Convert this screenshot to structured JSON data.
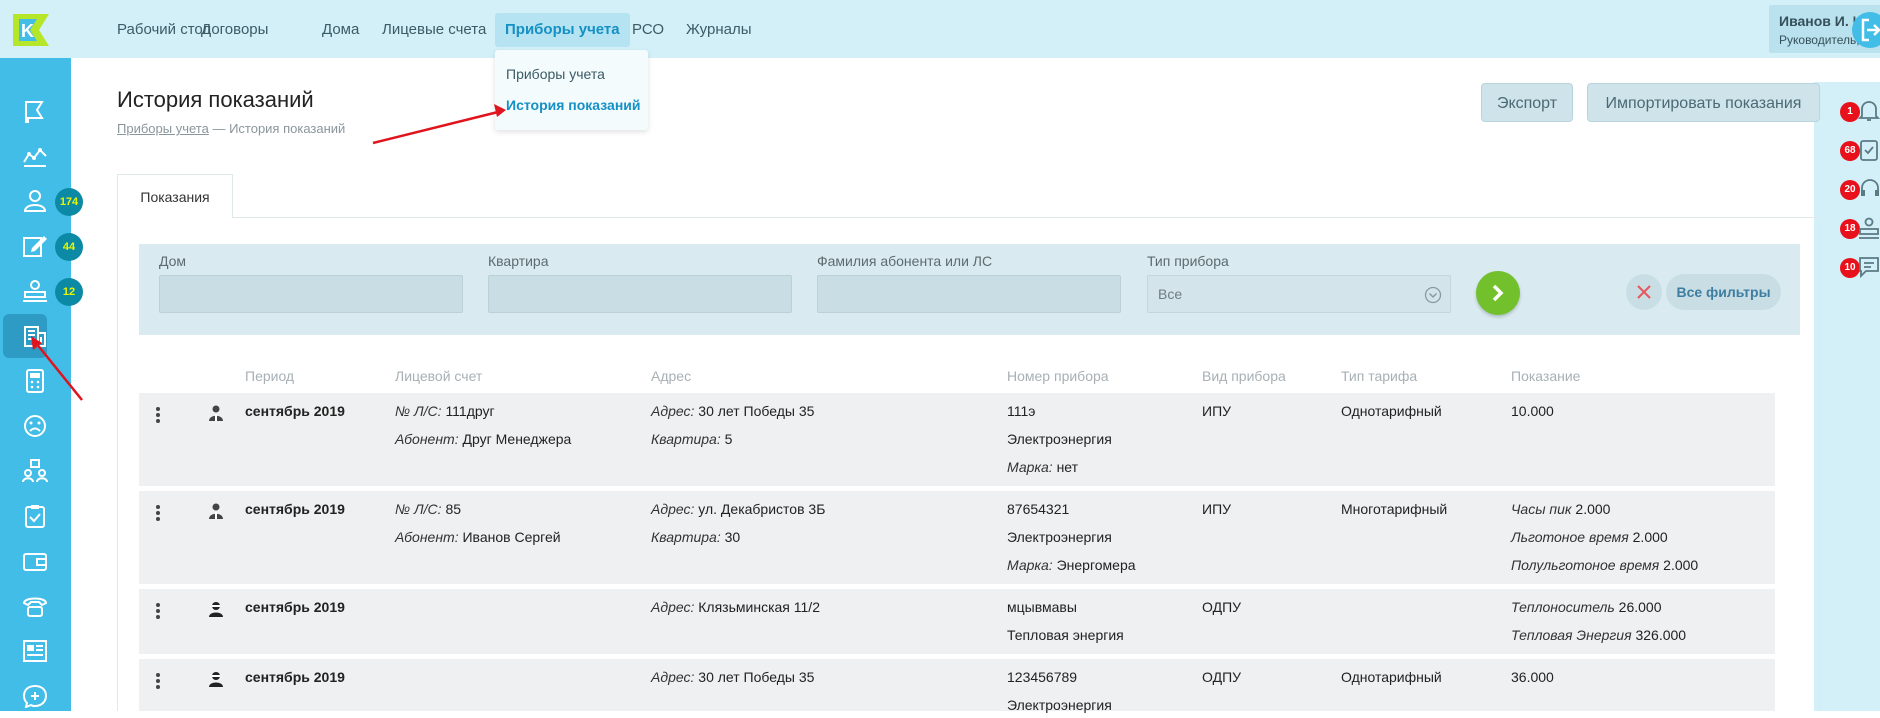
{
  "app": {
    "logo_letter": "K"
  },
  "nav": {
    "items": [
      "Рабочий стол",
      "Договоры",
      "Дома",
      "Лицевые счета",
      "Приборы учета",
      "РСО",
      "Журналы"
    ],
    "active": "Приборы учета",
    "dropdown": [
      "Приборы учета",
      "История показаний"
    ]
  },
  "user": {
    "name": "Иванов И. И.",
    "role": "Руководитель, Doctor"
  },
  "sidebar": {
    "badges": [
      "174",
      "44",
      "12"
    ]
  },
  "rightbar": {
    "badges": [
      "1",
      "68",
      "20",
      "18",
      "10"
    ]
  },
  "page": {
    "title": "История показаний",
    "breadcrumb": {
      "parent": "Приборы учета",
      "separator": "—",
      "current": "История показаний"
    }
  },
  "actions": {
    "export": "Экспорт",
    "import": "Импортировать показания"
  },
  "tabs": {
    "readings": "Показания"
  },
  "filters": {
    "house": "Дом",
    "apartment": "Квартира",
    "subscriber": "Фамилия абонента или ЛС",
    "device_type": "Тип прибора",
    "device_type_value": "Все",
    "all_filters": "Все фильтры"
  },
  "table": {
    "headers": {
      "period": "Период",
      "account": "Лицевой счет",
      "address": "Адрес",
      "device_no": "Номер прибора",
      "device_kind": "Вид прибора",
      "tariff": "Тип тарифа",
      "reading": "Показание"
    },
    "labels": {
      "ls": "№ Л/С:",
      "subscriber": "Абонент:",
      "address": "Адрес:",
      "apartment": "Квартира:",
      "brand": "Марка:"
    },
    "rows": [
      {
        "period": "сентябрь 2019",
        "ls": "111друг",
        "subscriber": "Друг Менеджера",
        "address": "30 лет Победы 35",
        "apartment": "5",
        "device_no": "111э",
        "resource": "Электроэнергия",
        "brand": "нет",
        "kind": "ИПУ",
        "tariff": "Однотарифный",
        "readings": [
          {
            "label": "",
            "value": "10.000"
          }
        ]
      },
      {
        "period": "сентябрь 2019",
        "ls": "85",
        "subscriber": "Иванов Сергей",
        "address": "ул. Декабристов 3Б",
        "apartment": "30",
        "device_no": "87654321",
        "resource": "Электроэнергия",
        "brand": "Энергомера",
        "kind": "ИПУ",
        "tariff": "Многотарифный",
        "readings": [
          {
            "label": "Часы пик",
            "value": "2.000"
          },
          {
            "label": "Льготоное время",
            "value": "2.000"
          },
          {
            "label": "Полульготоное время",
            "value": "2.000"
          }
        ]
      },
      {
        "period": "сентябрь 2019",
        "address": "Клязьминская 11/2",
        "device_no": "мцывмавы",
        "resource": "Тепловая энергия",
        "kind": "ОДПУ",
        "tariff": "",
        "readings": [
          {
            "label": "Теплоноситель",
            "value": "26.000"
          },
          {
            "label": "Тепловая Энергия",
            "value": "326.000"
          }
        ]
      },
      {
        "period": "сентябрь 2019",
        "address": "30 лет Победы 35",
        "device_no": "123456789",
        "resource": "Электроэнергия",
        "kind": "ОДПУ",
        "tariff": "Однотарифный",
        "readings": [
          {
            "label": "",
            "value": "36.000"
          }
        ]
      }
    ]
  },
  "colors": {
    "sidebar": "#41bde7",
    "topbar": "#d3f0f8",
    "accent": "#1590c5",
    "badge_red": "#e8111b",
    "badge_teal": "#0c8aa5",
    "go_green": "#72c12c"
  }
}
